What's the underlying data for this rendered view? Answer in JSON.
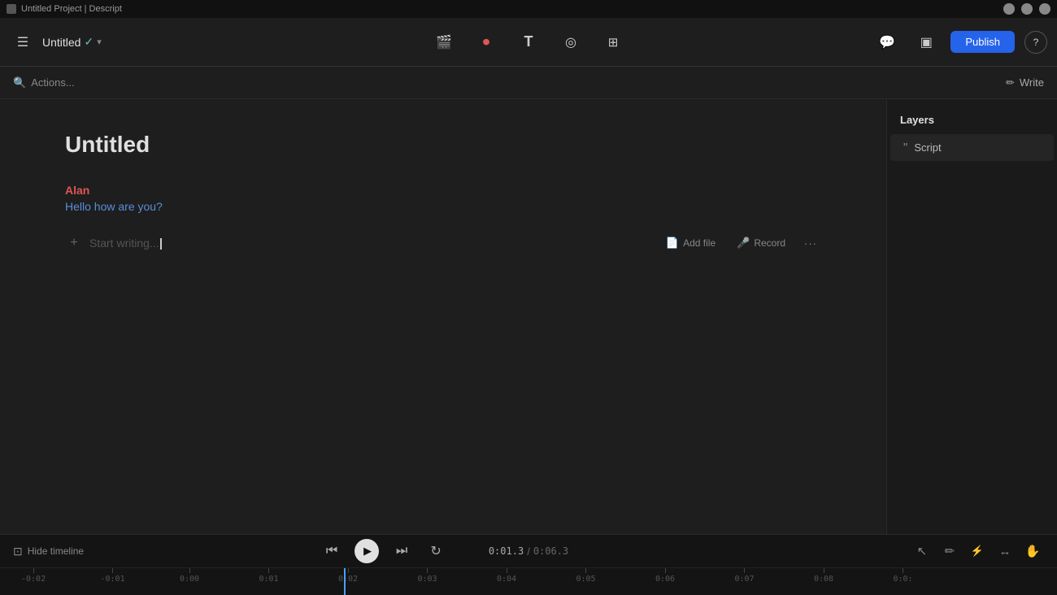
{
  "window": {
    "title": "Untitled Project | Descript"
  },
  "titlebar": {
    "title": "Untitled Project | Descript",
    "controls": [
      "minimize",
      "maximize",
      "close"
    ]
  },
  "toolbar": {
    "menu_icon": "☰",
    "project_name": "Untitled",
    "project_status_icon": "✓",
    "center_icons": [
      {
        "name": "camera-icon",
        "symbol": "⬛",
        "title": "Screen capture"
      },
      {
        "name": "record-icon",
        "symbol": "⏺",
        "title": "Record"
      },
      {
        "name": "text-icon",
        "symbol": "T",
        "title": "Text"
      },
      {
        "name": "shape-icon",
        "symbol": "◎",
        "title": "Shapes"
      },
      {
        "name": "grid-icon",
        "symbol": "⊞",
        "title": "Grid"
      }
    ],
    "right_icons": [
      {
        "name": "comment-icon",
        "symbol": "💬",
        "title": "Comments"
      },
      {
        "name": "layout-icon",
        "symbol": "▣",
        "title": "Layout"
      }
    ],
    "publish_label": "Publish",
    "help_icon": "?"
  },
  "secondary_toolbar": {
    "actions_label": "Actions...",
    "search_icon": "🔍",
    "write_label": "Write",
    "write_icon": "✏"
  },
  "editor": {
    "doc_title": "Untitled",
    "speaker_name": "Alan",
    "speaker_text": "Hello how are you?",
    "new_line_placeholder": "Start writing...",
    "plus_icon": "+",
    "add_file_label": "Add file",
    "record_label": "Record",
    "more_icon": "•••"
  },
  "sidebar": {
    "header": "Layers",
    "items": [
      {
        "label": "Script",
        "icon": "❝"
      }
    ]
  },
  "timeline": {
    "hide_label": "Hide timeline",
    "hide_icon": "⊡",
    "current_time": "0:01.3",
    "total_time": "0:06.3",
    "separator": "/",
    "skip_back_icon": "⏮",
    "play_icon": "▶",
    "skip_forward_icon": "⏭",
    "loop_icon": "↻",
    "tool_icons": [
      {
        "name": "select-tool",
        "symbol": "↖"
      },
      {
        "name": "edit-tool",
        "symbol": "✏"
      },
      {
        "name": "trim-tool",
        "symbol": "⚡"
      },
      {
        "name": "arrow-tool",
        "symbol": "↔"
      },
      {
        "name": "hand-tool",
        "symbol": "✋"
      }
    ],
    "ruler_marks": [
      {
        "label": "-0:02",
        "pos_pct": 2
      },
      {
        "label": "-0:01",
        "pos_pct": 9.5
      },
      {
        "label": "0:00",
        "pos_pct": 17
      },
      {
        "label": "0:01",
        "pos_pct": 24.5
      },
      {
        "label": "0:02",
        "pos_pct": 32
      },
      {
        "label": "0:03",
        "pos_pct": 39.5
      },
      {
        "label": "0:04",
        "pos_pct": 47
      },
      {
        "label": "0:05",
        "pos_pct": 54.5
      },
      {
        "label": "0:06",
        "pos_pct": 62
      },
      {
        "label": "0:07",
        "pos_pct": 69.5
      },
      {
        "label": "0:08",
        "pos_pct": 77
      },
      {
        "label": "0:0:",
        "pos_pct": 84.5
      }
    ],
    "playhead_pct": 32.5
  },
  "colors": {
    "speaker_name": "#e05555",
    "speaker_text": "#5b8dd9",
    "accent": "#2563eb",
    "playhead": "#4a9eff"
  }
}
